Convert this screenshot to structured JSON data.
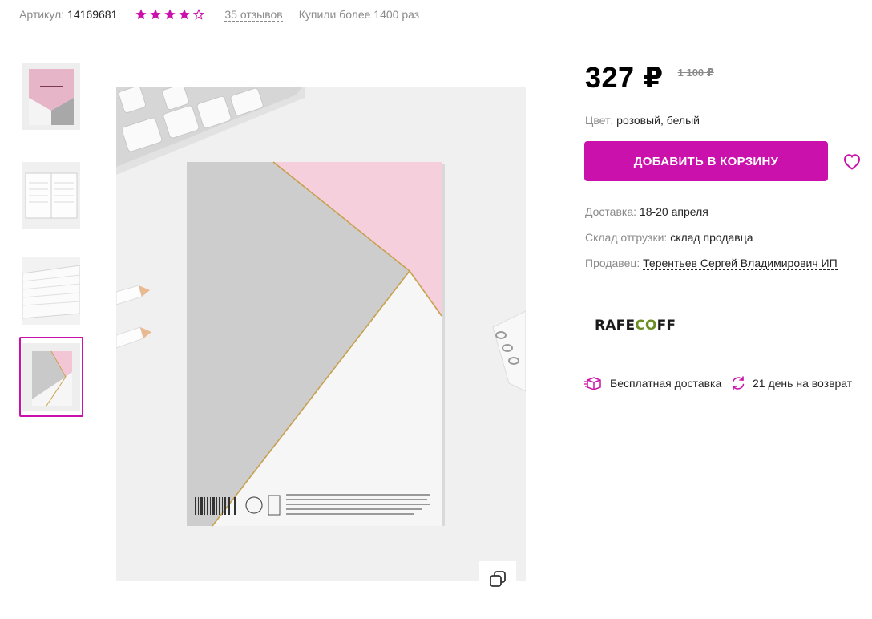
{
  "meta": {
    "sku_label": "Артикул:",
    "sku_value": "14169681",
    "rating": 4,
    "rating_max": 5,
    "reviews": "35 отзывов",
    "bought": "Купили более 1400 раз"
  },
  "gallery": {
    "thumbnails": [
      "cover-front",
      "open-pages",
      "page-edges",
      "cover-back"
    ],
    "active_index": 3,
    "zoom_icon": "copy-squares-icon"
  },
  "product": {
    "price": "327 ₽",
    "old_price": "1 100 ₽",
    "color_label": "Цвет:",
    "color_value": "розовый, белый",
    "cart_button": "ДОБАВИТЬ В КОРЗИНУ",
    "delivery_label": "Доставка:",
    "delivery_value": "18-20 апреля",
    "warehouse_label": "Склад отгрузки:",
    "warehouse_value": "склад продавца",
    "seller_label": "Продавец:",
    "seller_value": "Терентьев Сергей Владимирович ИП",
    "brand_part1": "RAFE",
    "brand_part2": "CO",
    "brand_part3": "FF",
    "free_delivery": "Бесплатная доставка",
    "return_policy": "21 день на возврат"
  },
  "colors": {
    "accent": "#cb11ab",
    "muted": "#8b8b8b",
    "text": "#242424",
    "brand_green": "#6b8e23"
  }
}
